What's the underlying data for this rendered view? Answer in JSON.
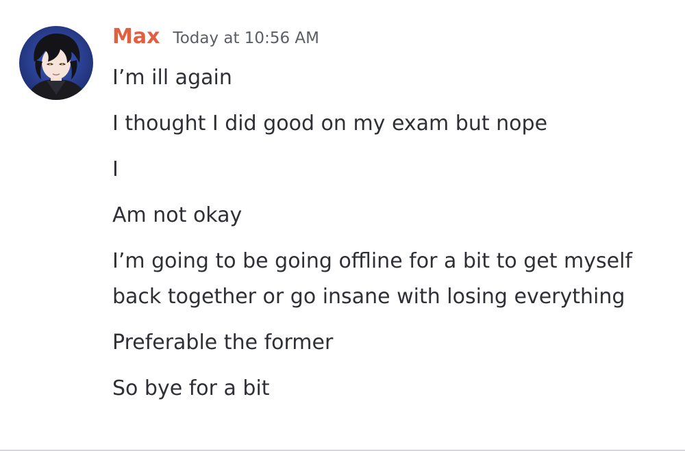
{
  "message": {
    "author": "Max",
    "timestamp": "Today at 10:56 AM",
    "lines": [
      "I’m ill again",
      "I thought I did good on my exam but nope",
      "I",
      "Am not okay",
      "I’m going to be going offline for a bit to get myself back together or go insane with losing everything",
      "Preferable the former",
      "So bye for a bit"
    ]
  },
  "colors": {
    "author": "#e06040",
    "timestamp": "#5c5e66",
    "text": "#2e3035",
    "avatar_bg": "#2a3f8c"
  },
  "icons": {
    "avatar": "anime-boy-avatar"
  }
}
